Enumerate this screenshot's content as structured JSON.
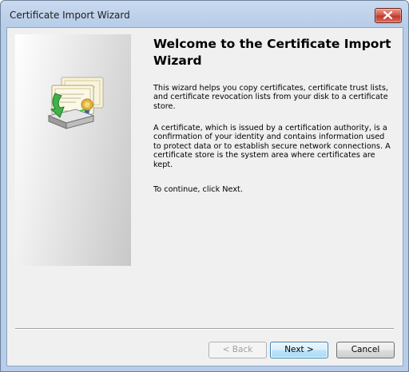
{
  "window": {
    "title": "Certificate Import Wizard"
  },
  "icons": {
    "close": "close-icon",
    "wizard": "certificate-import-icon"
  },
  "main": {
    "heading": "Welcome to the Certificate Import Wizard",
    "paragraph_1": "This wizard helps you copy certificates, certificate trust lists, and certificate revocation lists from your disk to a certificate store.",
    "paragraph_2": "A certificate, which is issued by a certification authority, is a confirmation of your identity and contains information used to protect data or to establish secure network connections. A certificate store is the system area where certificates are kept.",
    "paragraph_3": "To continue, click Next."
  },
  "buttons": {
    "back": "< Back",
    "next": "Next >",
    "cancel": "Cancel"
  },
  "colors": {
    "title_bar": "#b8cde8",
    "client_background": "#f0f0f0",
    "close_button": "#c0392b",
    "default_button_border": "#3c7fb1"
  }
}
